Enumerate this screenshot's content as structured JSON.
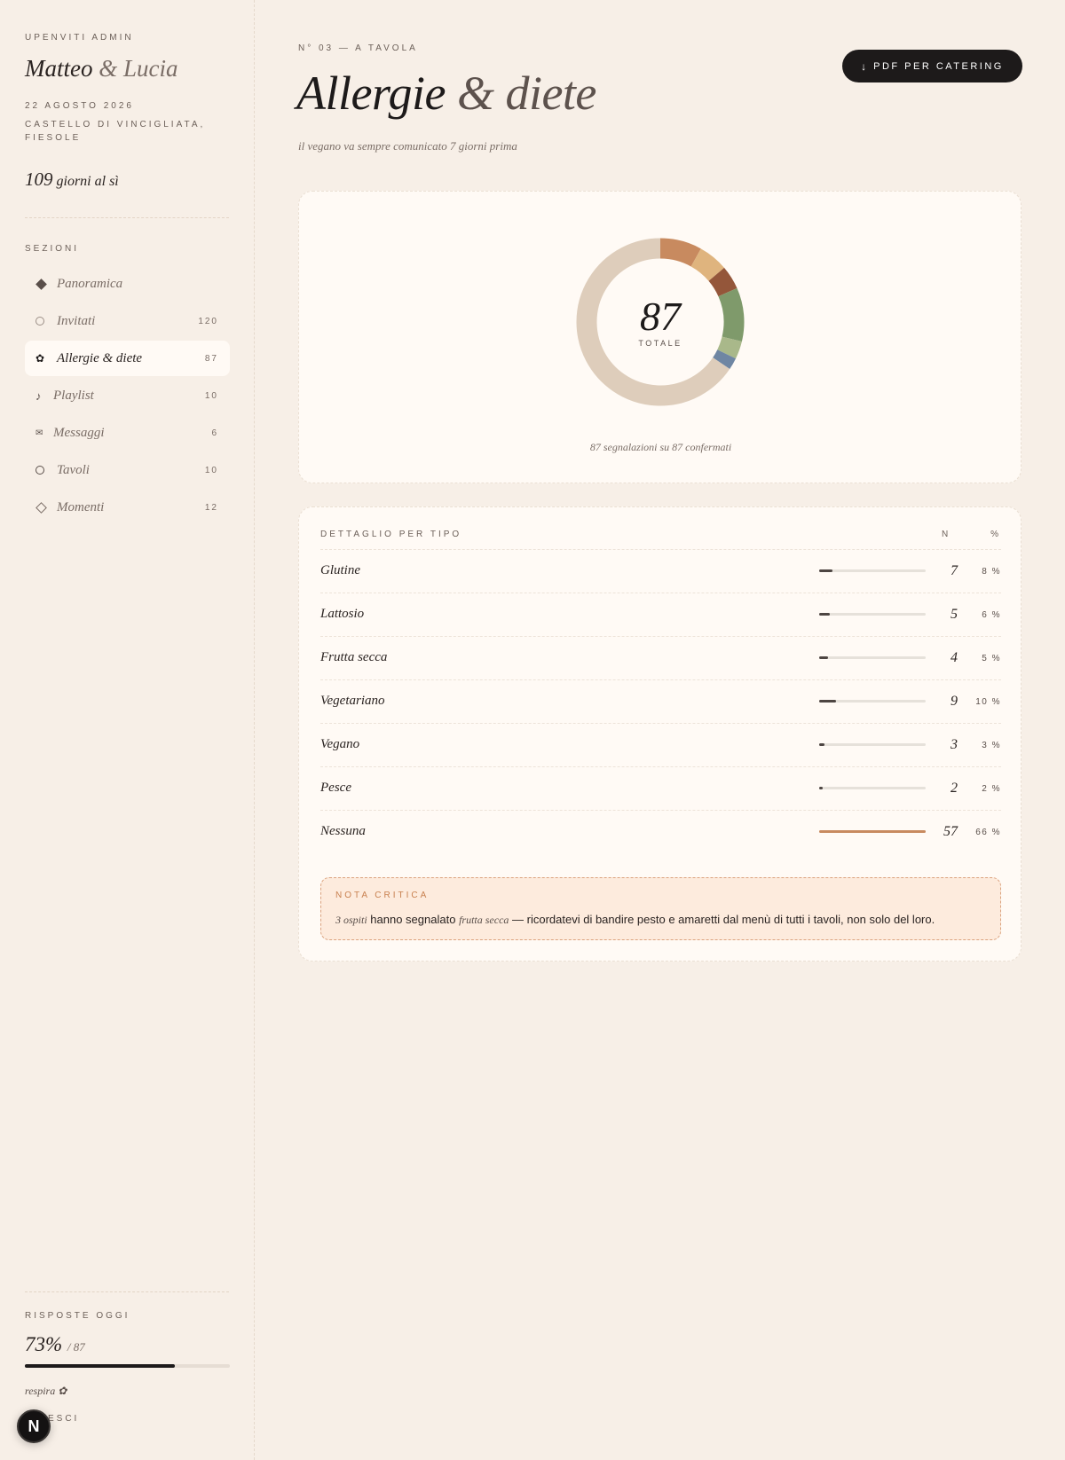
{
  "sidebar": {
    "brand": "UPENVITI ADMIN",
    "couple_first": "Matteo",
    "couple_amp": "&",
    "couple_second": "Lucia",
    "date": "22 AGOSTO 2026",
    "place": "CASTELLO DI VINCIGLIATA, FIESOLE",
    "countdown_number": "109",
    "countdown_text": "giorni al sì",
    "sections_label": "SEZIONI",
    "items": [
      {
        "label": "Panoramica",
        "count": "",
        "icon": "diamond-filled-icon"
      },
      {
        "label": "Invitati",
        "count": "120",
        "icon": "circle-outline-icon"
      },
      {
        "label": "Allergie & diete",
        "count": "87",
        "icon": "flower-icon"
      },
      {
        "label": "Playlist",
        "count": "10",
        "icon": "music-note-icon"
      },
      {
        "label": "Messaggi",
        "count": "6",
        "icon": "envelope-icon"
      },
      {
        "label": "Tavoli",
        "count": "10",
        "icon": "circle-bold-icon"
      },
      {
        "label": "Momenti",
        "count": "12",
        "icon": "diamond-outline-icon"
      }
    ],
    "active_index": 2,
    "responses_label": "RISPOSTE OGGI",
    "responses_percent": "73%",
    "responses_of": "/ 87",
    "responses_progress": 0.73,
    "breathe": "respira ✿",
    "exit": "ESCI",
    "badge": "N"
  },
  "header": {
    "kicker": "N° 03 — A TAVOLA",
    "title_main": "Allergie",
    "title_amp": "& diete",
    "subtitle": "il vegano va sempre comunicato 7 giorni prima",
    "pdf_button": "PDF PER CATERING",
    "pdf_icon": "arrow-down-icon"
  },
  "chart_data": {
    "type": "pie",
    "categories": [
      "Glutine",
      "Lattosio",
      "Frutta secca",
      "Vegetariano",
      "Vegano",
      "Pesce",
      "Nessuna"
    ],
    "values": [
      7,
      5,
      4,
      9,
      3,
      2,
      57
    ],
    "colors": [
      "#c88a5f",
      "#dfb47e",
      "#94563a",
      "#7f9a6b",
      "#a9b88a",
      "#6f86a3",
      "#decdbb"
    ],
    "total": "87",
    "total_label": "TOTALE",
    "caption": "87 segnalazioni su 87 confermati"
  },
  "detail": {
    "title": "DETTAGLIO PER TIPO",
    "col_n": "N",
    "col_pct": "%",
    "rows": [
      {
        "name": "Glutine",
        "n": "7",
        "pct": "8 %",
        "fraction": 0.08
      },
      {
        "name": "Lattosio",
        "n": "5",
        "pct": "6 %",
        "fraction": 0.06
      },
      {
        "name": "Frutta secca",
        "n": "4",
        "pct": "5 %",
        "fraction": 0.05
      },
      {
        "name": "Vegetariano",
        "n": "9",
        "pct": "10 %",
        "fraction": 0.1
      },
      {
        "name": "Vegano",
        "n": "3",
        "pct": "3 %",
        "fraction": 0.03
      },
      {
        "name": "Pesce",
        "n": "2",
        "pct": "2 %",
        "fraction": 0.02
      },
      {
        "name": "Nessuna",
        "n": "57",
        "pct": "66 %",
        "fraction": 0.66
      }
    ],
    "accent_row": 6
  },
  "note": {
    "title": "NOTA CRITICA",
    "count_text": "3 ospiti",
    "text_before": "hanno segnalato",
    "highlight": "frutta secca",
    "text_after": "— ricordatevi di bandire pesto e amaretti dal menù di tutti i tavoli, non solo del loro."
  }
}
